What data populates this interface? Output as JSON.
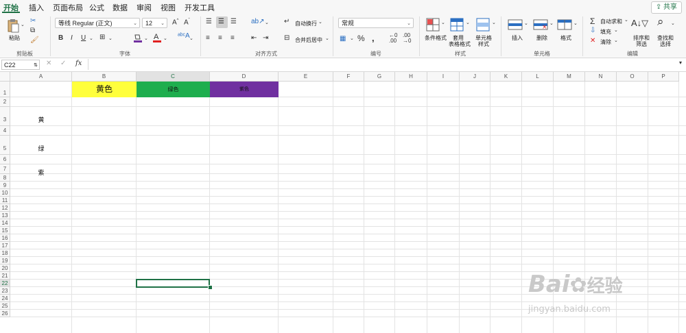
{
  "tabs": [
    "开始",
    "插入",
    "页面布局",
    "公式",
    "数据",
    "审阅",
    "视图",
    "开发工具"
  ],
  "share_label": "共享",
  "ribbon": {
    "paste": "粘贴",
    "font_name": "等线 Regular (正文)",
    "font_size": "12",
    "wrap_text": "自动换行",
    "merge_center": "合并后居中",
    "number_format": "常规",
    "cond_format": "条件格式",
    "table_format_1": "套用",
    "table_format_2": "表格格式",
    "cell_style_1": "单元格",
    "cell_style_2": "样式",
    "insert": "插入",
    "delete": "删除",
    "format": "格式",
    "autosum": "自动求和",
    "fill": "填充",
    "clear": "清除",
    "sort_1": "排序和",
    "sort_2": "筛选",
    "find_1": "查找和",
    "find_2": "选择",
    "groups": {
      "clipboard": "剪贴板",
      "font": "字体",
      "align": "对齐方式",
      "number": "编号",
      "styles": "样式",
      "cells": "单元格",
      "editing": "编辑"
    }
  },
  "formula_bar": {
    "name_box": "C22",
    "fx": "fx",
    "content": ""
  },
  "columns": [
    "A",
    "B",
    "C",
    "D",
    "E",
    "F",
    "G",
    "H",
    "I",
    "J",
    "K",
    "L",
    "M",
    "N",
    "O",
    "P"
  ],
  "rows": [
    "1",
    "2",
    "3",
    "4",
    "5",
    "6",
    "7",
    "8",
    "9",
    "10",
    "11",
    "12",
    "13",
    "14",
    "15",
    "16",
    "17",
    "18",
    "19",
    "20",
    "21",
    "22",
    "23",
    "24",
    "25",
    "26"
  ],
  "cells": {
    "B1": "黄色",
    "C1": "绿色",
    "D1": "紫色",
    "A3": "黄",
    "A5": "绿",
    "A7": "紫"
  },
  "colors": {
    "yellow": "#ffff3c",
    "green": "#1eae4e",
    "purple": "#7030a0",
    "accent": "#1e7145"
  },
  "selected_cell": "C22",
  "watermark": {
    "brand": "Bai",
    "brand_cn": "经验",
    "url": "jingyan.baidu.com"
  }
}
